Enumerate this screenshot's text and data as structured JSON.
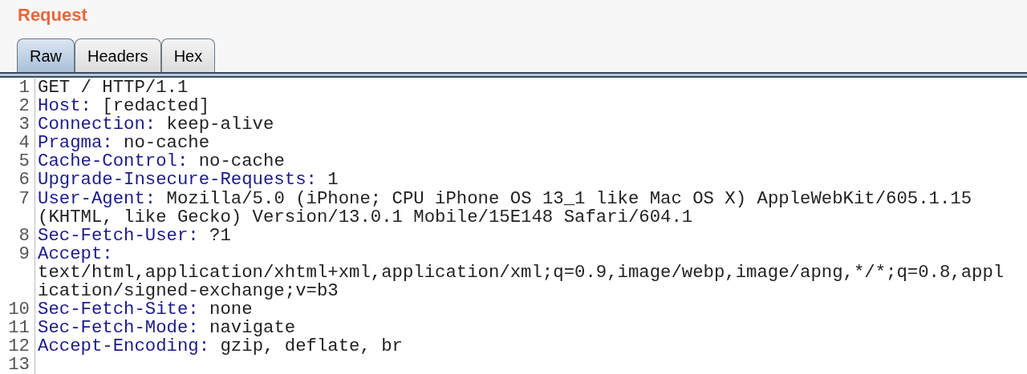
{
  "title": "Request",
  "tabs": [
    {
      "label": "Raw",
      "selected": true
    },
    {
      "label": "Headers",
      "selected": false
    },
    {
      "label": "Hex",
      "selected": false
    }
  ],
  "lines": [
    {
      "number": "1",
      "kind": "plain",
      "value_lines": [
        "GET / HTTP/1.1"
      ]
    },
    {
      "number": "2",
      "kind": "header",
      "name": "Host:",
      "value_lines": [
        "[redacted]"
      ]
    },
    {
      "number": "3",
      "kind": "header",
      "name": "Connection:",
      "value_lines": [
        "keep-alive"
      ]
    },
    {
      "number": "4",
      "kind": "header",
      "name": "Pragma:",
      "value_lines": [
        "no-cache"
      ]
    },
    {
      "number": "5",
      "kind": "header",
      "name": "Cache-Control:",
      "value_lines": [
        "no-cache"
      ]
    },
    {
      "number": "6",
      "kind": "header",
      "name": "Upgrade-Insecure-Requests:",
      "value_lines": [
        "1"
      ]
    },
    {
      "number": "7",
      "kind": "header",
      "name": "User-Agent:",
      "value_lines": [
        "Mozilla/5.0 (iPhone; CPU iPhone OS 13_1 like Mac OS X) AppleWebKit/605.1.15",
        "(KHTML, like Gecko) Version/13.0.1 Mobile/15E148 Safari/604.1"
      ]
    },
    {
      "number": "8",
      "kind": "header",
      "name": "Sec-Fetch-User:",
      "value_lines": [
        "?1"
      ]
    },
    {
      "number": "9",
      "kind": "header_wrapped",
      "name": "Accept:",
      "value_lines": [
        "text/html,application/xhtml+xml,application/xml;q=0.9,image/webp,image/apng,*/*;q=0.8,appl",
        "ication/signed-exchange;v=b3"
      ]
    },
    {
      "number": "10",
      "kind": "header",
      "name": "Sec-Fetch-Site:",
      "value_lines": [
        "none"
      ]
    },
    {
      "number": "11",
      "kind": "header",
      "name": "Sec-Fetch-Mode:",
      "value_lines": [
        "navigate"
      ]
    },
    {
      "number": "12",
      "kind": "header",
      "name": "Accept-Encoding:",
      "value_lines": [
        "gzip, deflate, br"
      ]
    },
    {
      "number": "13",
      "kind": "blank"
    }
  ]
}
